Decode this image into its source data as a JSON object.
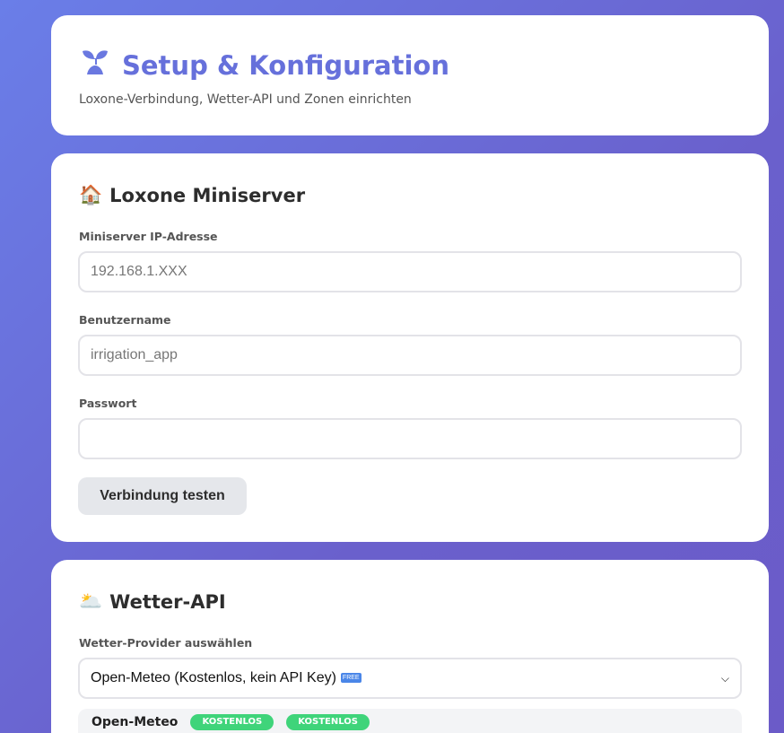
{
  "header": {
    "title": "Setup & Konfiguration",
    "subtitle": "Loxone-Verbindung, Wetter-API und Zonen einrichten",
    "icon": "seedling-icon"
  },
  "loxone": {
    "title": "Loxone Miniserver",
    "icon": "house-icon",
    "ip_label": "Miniserver IP-Adresse",
    "ip_placeholder": "192.168.1.XXX",
    "user_label": "Benutzername",
    "user_placeholder": "irrigation_app",
    "pass_label": "Passwort",
    "pass_value": "",
    "test_button": "Verbindung testen"
  },
  "weather": {
    "title": "Wetter-API",
    "icon": "sun-behind-cloud-icon",
    "provider_label": "Wetter-Provider auswählen",
    "provider_selected": "Open-Meteo (Kostenlos, kein API Key)",
    "free_badge": "FREE",
    "info_name": "Open-Meteo",
    "badges": [
      "KOSTENLOS",
      "KOSTENLOS"
    ]
  },
  "colors": {
    "accent": "#6670db",
    "badge": "#3fd47a"
  }
}
